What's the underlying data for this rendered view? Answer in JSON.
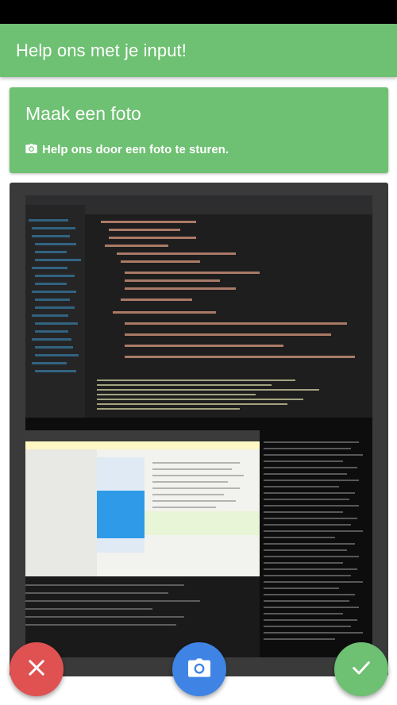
{
  "header": {
    "title": "Help ons met je input!"
  },
  "card": {
    "title": "Maak een foto",
    "subtitle": "Help ons door een foto te sturen.",
    "subtitle_icon": "camera-icon"
  },
  "photo": {
    "description_icon": "photo"
  },
  "actions": {
    "cancel_icon": "close-icon",
    "camera_icon": "camera-icon",
    "confirm_icon": "check-icon"
  },
  "colors": {
    "primary": "#6ec072",
    "cancel": "#e05252",
    "camera": "#3f84e5",
    "frame": "#3a3a3a"
  }
}
